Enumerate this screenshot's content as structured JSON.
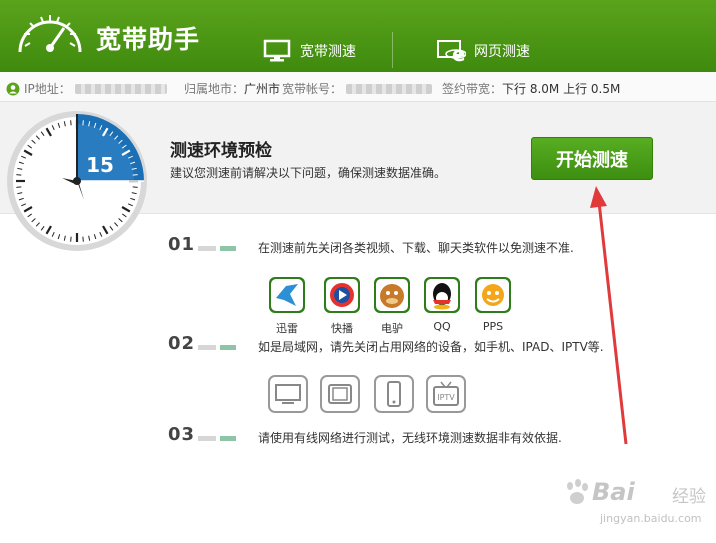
{
  "header": {
    "app_title": "宽带助手",
    "tabs": [
      {
        "label": "宽带测速",
        "icon": "monitor-icon"
      },
      {
        "label": "网页测速",
        "icon": "ie-browser-icon"
      }
    ]
  },
  "infobar": {
    "ip_label": "IP地址：",
    "location_label": "归属地市：",
    "location_value": "广州市",
    "account_label": "宽带帐号：",
    "bandwidth_label": "签约带宽：",
    "bandwidth_value": "下行 8.0M 上行 0.5M"
  },
  "check": {
    "timer_value": "15",
    "title": "测速环境预检",
    "description": "建议您测速前请解决以下问题，确保测速数据准确。",
    "start_button": "开始测速"
  },
  "steps": [
    {
      "num": "01",
      "text": "在测速前先关闭各类视频、下载、聊天类软件以免测速不准."
    },
    {
      "num": "02",
      "text": "如是局域网，请先关闭占用网络的设备，如手机、IPAD、IPTV等."
    },
    {
      "num": "03",
      "text": "请使用有线网络进行测试，无线环境测速数据非有效依据."
    }
  ],
  "apps": [
    {
      "label": "迅雷",
      "icon": "xunlei-icon"
    },
    {
      "label": "快播",
      "icon": "kuaibo-icon"
    },
    {
      "label": "电驴",
      "icon": "emule-icon"
    },
    {
      "label": "QQ",
      "icon": "qq-icon"
    },
    {
      "label": "PPS",
      "icon": "pps-icon"
    }
  ],
  "devices": [
    {
      "icon": "tv-icon"
    },
    {
      "icon": "tablet-icon"
    },
    {
      "icon": "phone-icon"
    },
    {
      "icon": "iptv-icon",
      "label": "IPTV"
    }
  ],
  "watermark": {
    "brand": "Bai",
    "brand_suffix": "经验",
    "url": "jingyan.baidu.com"
  },
  "colors": {
    "header_green": "#4a9a14",
    "button_green": "#4ba01a",
    "timer_blue": "#1a6fb5",
    "arrow_red": "#e03a3a"
  }
}
